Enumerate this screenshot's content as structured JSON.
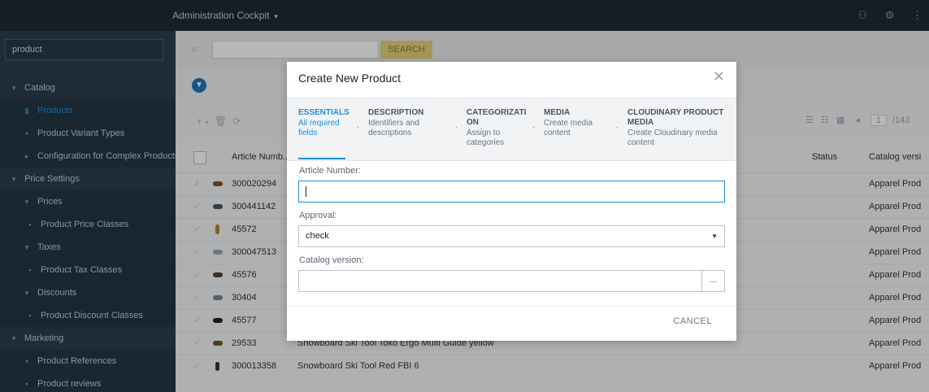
{
  "app": {
    "title": "Administration Cockpit"
  },
  "sidebar": {
    "search_value": "product",
    "items": [
      {
        "label": "Catalog"
      },
      {
        "label": "Products"
      },
      {
        "label": "Product Variant Types"
      },
      {
        "label": "Configuration for Complex Products"
      },
      {
        "label": "Price Settings"
      },
      {
        "label": "Prices"
      },
      {
        "label": "Product Price Classes"
      },
      {
        "label": "Taxes"
      },
      {
        "label": "Product Tax Classes"
      },
      {
        "label": "Discounts"
      },
      {
        "label": "Product Discount Classes"
      },
      {
        "label": "Marketing"
      },
      {
        "label": "Product References"
      },
      {
        "label": "Product reviews"
      }
    ]
  },
  "main": {
    "search_button": "SEARCH",
    "pagination": {
      "page": "1",
      "total": "/143"
    },
    "columns": {
      "article": "Article Numb...",
      "status": "Status",
      "catalog": "Catalog versi"
    },
    "rows": [
      {
        "article": "300020294",
        "name": "",
        "catalog": "Apparel Prod"
      },
      {
        "article": "300441142",
        "name": "",
        "catalog": "Apparel Prod"
      },
      {
        "article": "45572",
        "name": "",
        "catalog": "Apparel Prod"
      },
      {
        "article": "300047513",
        "name": "",
        "catalog": "Apparel Prod"
      },
      {
        "article": "45576",
        "name": "",
        "catalog": "Apparel Prod"
      },
      {
        "article": "30404",
        "name": "",
        "catalog": "Apparel Prod"
      },
      {
        "article": "45577",
        "name": "",
        "catalog": "Apparel Prod"
      },
      {
        "article": "29533",
        "name": "Snowboard Ski Tool Toko Ergo Multi Guide yellow",
        "catalog": "Apparel Prod"
      },
      {
        "article": "300013358",
        "name": "Snowboard Ski Tool Red FBI 6",
        "catalog": "Apparel Prod"
      }
    ]
  },
  "modal": {
    "title": "Create New Product",
    "steps": [
      {
        "title": "ESSENTIALS",
        "desc1": "All required",
        "desc2": "fields",
        "desc3": ""
      },
      {
        "title": "DESCRIPTION",
        "desc1": "Identifiers and",
        "desc2": "descriptions",
        "desc3": ""
      },
      {
        "title": "CATEGORIZATI",
        "title2": "ON",
        "desc1": "Assign to",
        "desc2": "categories",
        "desc3": ""
      },
      {
        "title": "MEDIA",
        "desc1": "Create media",
        "desc2": "content",
        "desc3": ""
      },
      {
        "title": "CLOUDINARY PRODUCT",
        "title2": "MEDIA",
        "desc1": "Create Cloudinary media",
        "desc2": "content",
        "desc3": ""
      }
    ],
    "fields": {
      "article_label": "Article Number:",
      "article_value": "",
      "approval_label": "Approval:",
      "approval_value": "check",
      "catalog_label": "Catalog version:",
      "catalog_value": "",
      "catalog_button": "..."
    },
    "cancel_label": "CANCEL"
  },
  "colors": {
    "accent": "#1e8fd8",
    "sidebar": "#2c3e4d",
    "topbar": "#1b2a36",
    "search_button": "#e3d27a"
  }
}
